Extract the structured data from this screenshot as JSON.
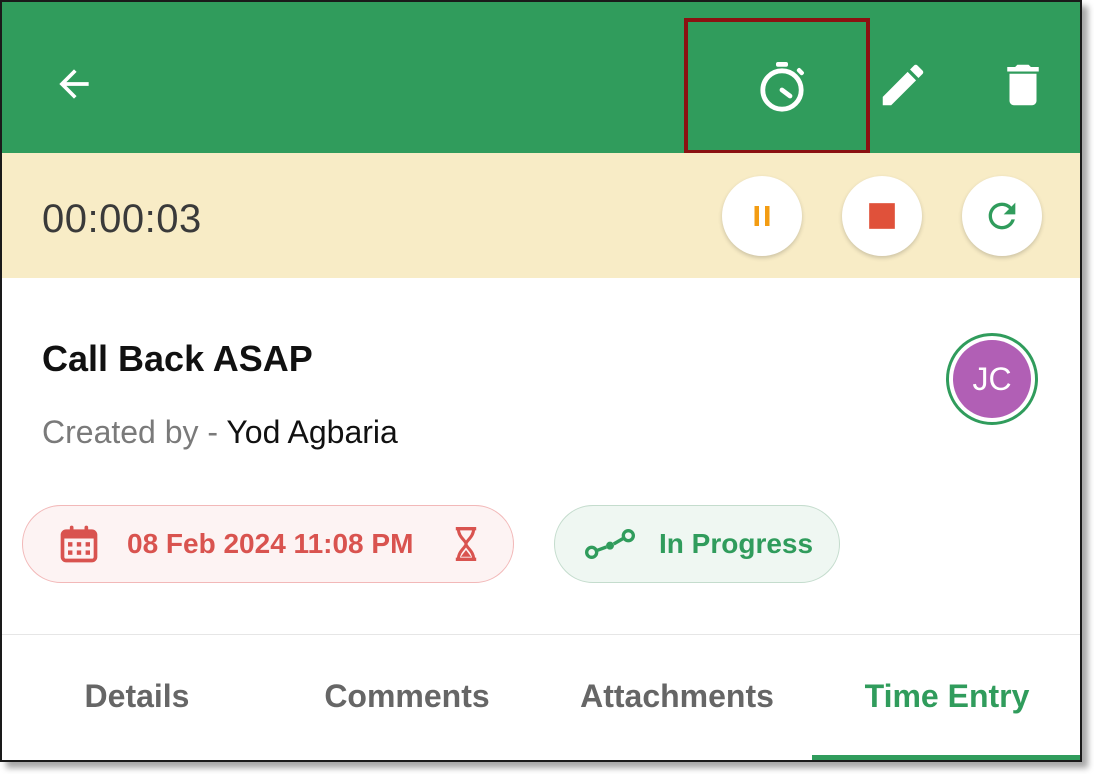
{
  "app_bar": {
    "back_icon": "arrow-left-icon",
    "timer_icon": "stopwatch-icon",
    "edit_icon": "pencil-icon",
    "delete_icon": "trash-icon",
    "background_color": "#309c5c"
  },
  "timer": {
    "elapsed": "00:00:03",
    "pause_icon": "pause-icon",
    "stop_icon": "stop-icon",
    "restart_icon": "restart-icon",
    "background_color": "#f8ecc6"
  },
  "task": {
    "title": "Call Back ASAP",
    "created_label": "Created by - ",
    "created_by": "Yod Agbaria",
    "assignee_initials": "JC",
    "avatar_color": "#b15fb5",
    "due_date": "08 Feb 2024 11:08 PM",
    "due_icon": "calendar-icon",
    "overdue_icon": "hourglass-icon",
    "status": "In Progress",
    "status_icon": "progress-path-icon"
  },
  "tabs": [
    {
      "label": "Details",
      "active": false
    },
    {
      "label": "Comments",
      "active": false
    },
    {
      "label": "Attachments",
      "active": false
    },
    {
      "label": "Time Entry",
      "active": true
    }
  ],
  "colors": {
    "accent": "#309c5c",
    "danger": "#d9534f",
    "pause": "#f39c12",
    "stop": "#e0513a"
  }
}
